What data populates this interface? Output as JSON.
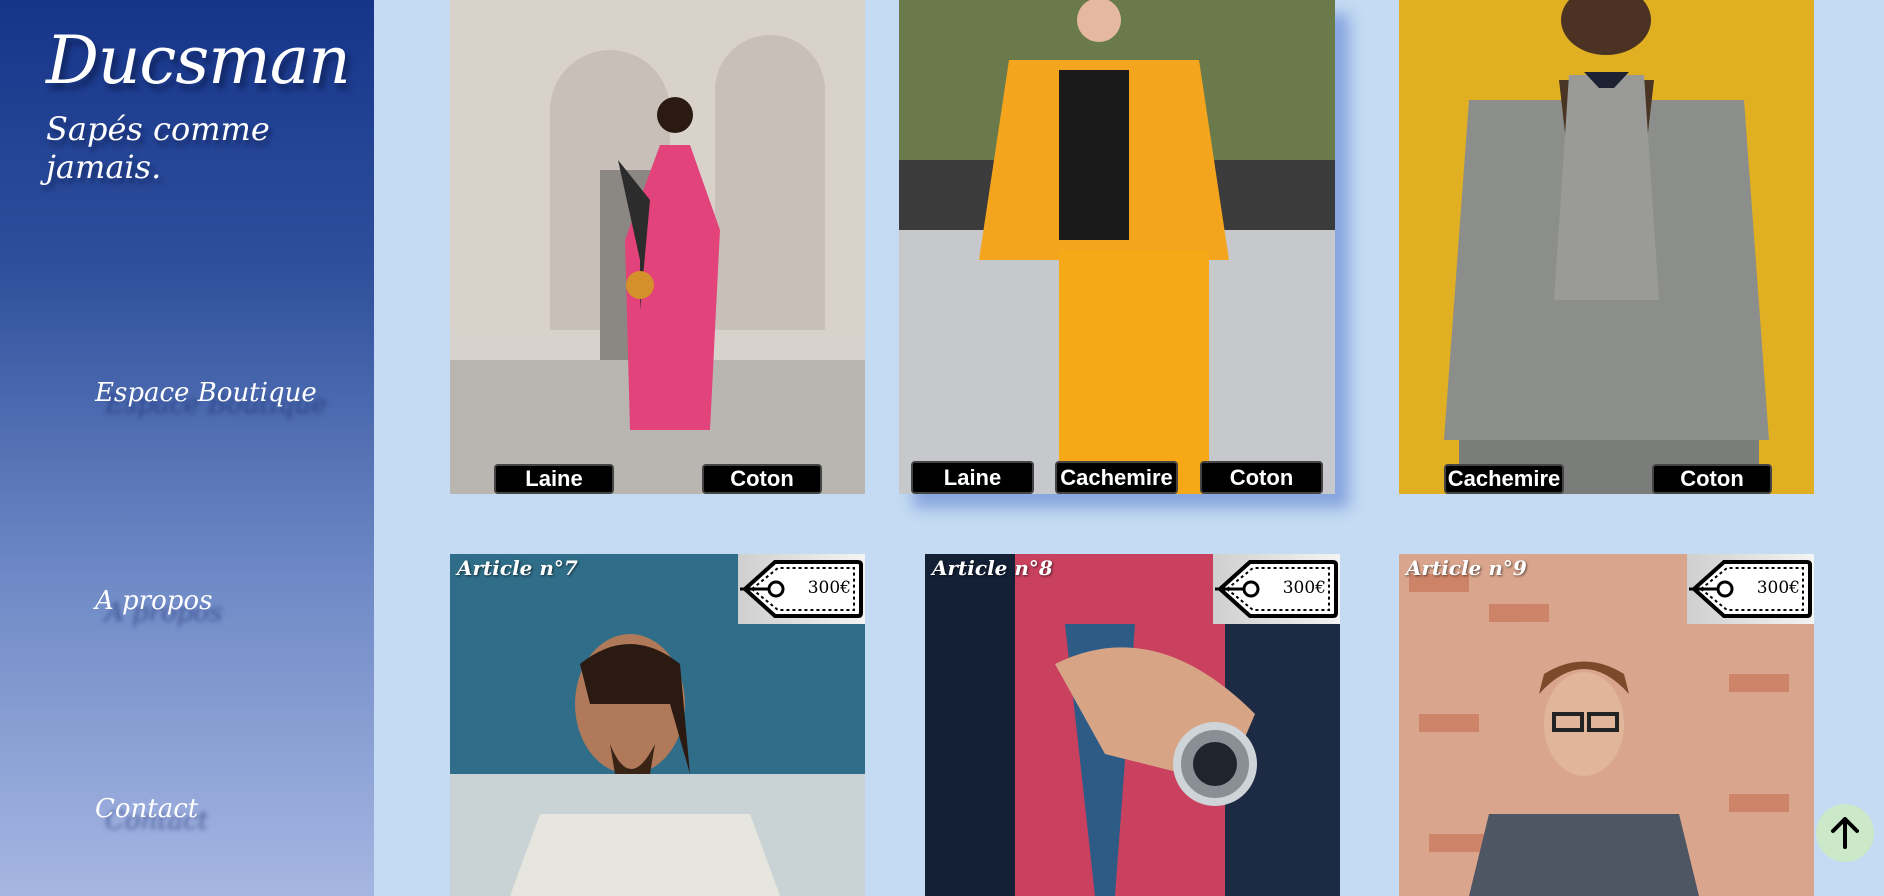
{
  "sidebar": {
    "brand": "Ducsman",
    "tagline": "Sapés comme jamais.",
    "nav": [
      "Espace Boutique",
      "A propos",
      "Contact"
    ]
  },
  "products_top": [
    {
      "image": "woman in pink suit",
      "materials": [
        "Laine",
        "Coton"
      ]
    },
    {
      "image": "woman in orange suit",
      "materials": [
        "Laine",
        "Cachemire",
        "Coton"
      ]
    },
    {
      "image": "woman in grey blazer",
      "materials": [
        "Cachemire",
        "Coton"
      ]
    }
  ],
  "products_bottom": [
    {
      "title": "Article n°7",
      "price": "300€",
      "image": "man with long hair"
    },
    {
      "title": "Article n°8",
      "price": "300€",
      "image": "man with watch and tie"
    },
    {
      "title": "Article n°9",
      "price": "300€",
      "image": "young man with glasses"
    }
  ],
  "icons": {
    "scroll_top": "arrow-up-icon",
    "price_tag": "price-tag-icon"
  },
  "colors": {
    "background": "#c5dbf3",
    "sidebar_top": "#16358a",
    "sidebar_bottom": "#a6b6e2"
  }
}
